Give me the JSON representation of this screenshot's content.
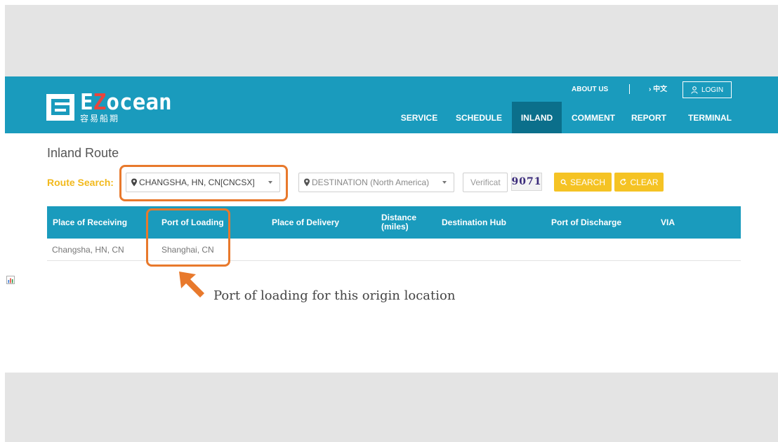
{
  "brand": {
    "name_prefix": "E",
    "name_accent": "Z",
    "name_rest": "ocean",
    "subtitle": "容易船期",
    "colors": {
      "nav": "#1a9bbd",
      "nav_active": "#0b6f8b",
      "accent_red": "#e8453c",
      "yellow": "#f5c324",
      "highlight": "#e8792c"
    }
  },
  "topbar": {
    "about": "ABOUT US",
    "lang": "› 中文",
    "login": "LOGIN"
  },
  "menu": {
    "items": [
      {
        "label": "SERVICE",
        "active": false
      },
      {
        "label": "SCHEDULE",
        "active": false
      },
      {
        "label": "INLAND",
        "active": true
      },
      {
        "label": "COMMENT",
        "active": false
      },
      {
        "label": "REPORT",
        "active": false
      },
      {
        "label": "TERMINAL",
        "active": false
      }
    ]
  },
  "page": {
    "title": "Inland Route"
  },
  "search": {
    "label": "Route Search:",
    "origin_value": "CHANGSHA, HN, CN[CNCSX]",
    "destination_placeholder": "DESTINATION (North America)",
    "verification_placeholder": "Verificat",
    "captcha_text": "9071",
    "search_label": "SEARCH",
    "clear_label": "CLEAR"
  },
  "table": {
    "headers": [
      "Place of Receiving",
      "Port of Loading",
      "Place of Delivery",
      "Distance (miles)",
      "Destination Hub",
      "Port of Discharge",
      "VIA"
    ],
    "rows": [
      [
        "Changsha, HN, CN",
        "Shanghai, CN",
        "",
        "",
        "",
        "",
        ""
      ]
    ]
  },
  "annotation": {
    "text": "Port of loading for this origin location"
  }
}
